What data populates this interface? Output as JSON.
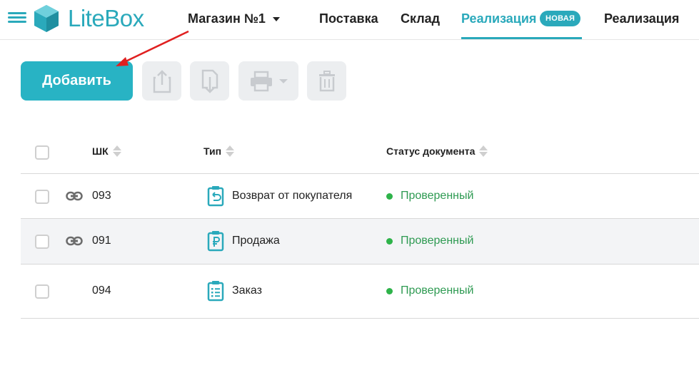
{
  "header": {
    "logo_text": "LiteBox",
    "store_label": "Магазин №1",
    "nav": [
      {
        "label": "Поставка"
      },
      {
        "label": "Склад"
      },
      {
        "label": "Реализация"
      },
      {
        "label": "Реализация"
      }
    ],
    "badge": "НОВАЯ",
    "accent_color": "#2aa9bb"
  },
  "toolbar": {
    "add_label": "Добавить",
    "icons": [
      "export-icon",
      "import-icon",
      "print-icon",
      "delete-icon"
    ]
  },
  "table": {
    "headers": {
      "barcode": "ШК",
      "type": "Тип",
      "status": "Статус документа"
    },
    "rows": [
      {
        "barcode": "093",
        "type": "Возврат от покупателя",
        "type_icon": "return-document-icon",
        "status": "Проверенный",
        "linked": true
      },
      {
        "barcode": "091",
        "type": "Продажа",
        "type_icon": "sale-document-icon",
        "status": "Проверенный",
        "linked": true
      },
      {
        "barcode": "094",
        "type": "Заказ",
        "type_icon": "order-document-icon",
        "status": "Проверенный",
        "linked": false
      }
    ],
    "status_color": "#2e9a52"
  }
}
